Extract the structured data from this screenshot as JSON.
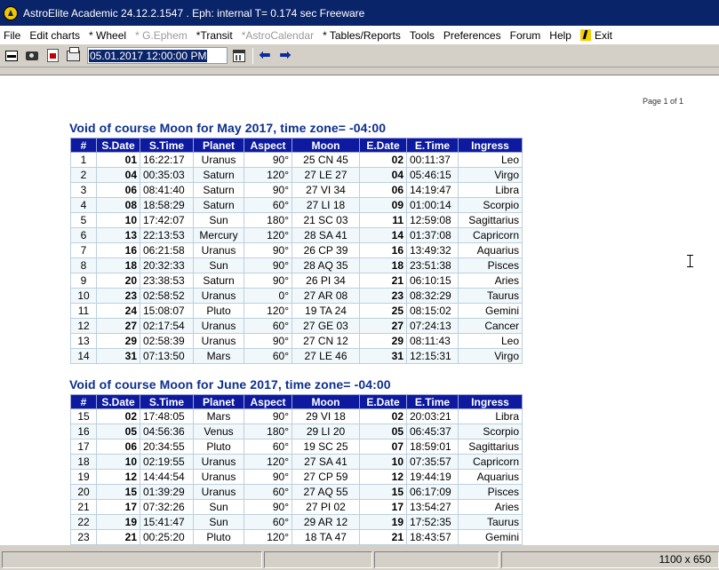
{
  "window": {
    "title": "AstroElite Academic 24.12.2.1547 . Eph: internal T= 0.174 sec Freeware"
  },
  "menu": {
    "items": [
      {
        "label": "File",
        "enabled": true
      },
      {
        "label": "Edit charts",
        "enabled": true
      },
      {
        "label": "* Wheel",
        "enabled": true
      },
      {
        "label": "* G.Ephem",
        "enabled": false
      },
      {
        "label": "*Transit",
        "enabled": true
      },
      {
        "label": "*AstroCalendar",
        "enabled": false
      },
      {
        "label": "* Tables/Reports",
        "enabled": true
      },
      {
        "label": "Tools",
        "enabled": true
      },
      {
        "label": "Preferences",
        "enabled": true
      },
      {
        "label": "Forum",
        "enabled": true
      },
      {
        "label": "Help",
        "enabled": true
      }
    ],
    "exit_label": "Exit"
  },
  "toolbar": {
    "datetime_value": "05.01.2017  12:00:00 PM",
    "icons": [
      "window-icon",
      "camera-icon",
      "pdf-icon",
      "printer-icon",
      "calendar-icon",
      "arrow-left-icon",
      "arrow-right-icon"
    ]
  },
  "report": {
    "page_label": "Page 1 of 1",
    "columns": [
      "#",
      "S.Date",
      "S.Time",
      "Planet",
      "Aspect",
      "Moon",
      "E.Date",
      "E.Time",
      "Ingress"
    ],
    "sections": [
      {
        "title": "Void of course Moon for  May 2017, time zone= -04:00",
        "rows": [
          [
            "1",
            "01",
            "16:22:17",
            "Uranus",
            "90°",
            "25 CN 45",
            "02",
            "00:11:37",
            "Leo"
          ],
          [
            "2",
            "04",
            "00:35:03",
            "Saturn",
            "120°",
            "27 LE 27",
            "04",
            "05:46:15",
            "Virgo"
          ],
          [
            "3",
            "06",
            "08:41:40",
            "Saturn",
            "90°",
            "27 VI 34",
            "06",
            "14:19:47",
            "Libra"
          ],
          [
            "4",
            "08",
            "18:58:29",
            "Saturn",
            "60°",
            "27 LI 18",
            "09",
            "01:00:14",
            "Scorpio"
          ],
          [
            "5",
            "10",
            "17:42:07",
            "Sun",
            "180°",
            "21 SC 03",
            "11",
            "12:59:08",
            "Sagittarius"
          ],
          [
            "6",
            "13",
            "22:13:53",
            "Mercury",
            "120°",
            "28 SA 41",
            "14",
            "01:37:08",
            "Capricorn"
          ],
          [
            "7",
            "16",
            "06:21:58",
            "Uranus",
            "90°",
            "26 CP 39",
            "16",
            "13:49:32",
            "Aquarius"
          ],
          [
            "8",
            "18",
            "20:32:33",
            "Sun",
            "90°",
            "28 AQ 35",
            "18",
            "23:51:38",
            "Pisces"
          ],
          [
            "9",
            "20",
            "23:38:53",
            "Saturn",
            "90°",
            "26 PI 34",
            "21",
            "06:10:15",
            "Aries"
          ],
          [
            "10",
            "23",
            "02:58:52",
            "Uranus",
            "0°",
            "27 AR 08",
            "23",
            "08:32:29",
            "Taurus"
          ],
          [
            "11",
            "24",
            "15:08:07",
            "Pluto",
            "120°",
            "19 TA 24",
            "25",
            "08:15:02",
            "Gemini"
          ],
          [
            "12",
            "27",
            "02:17:54",
            "Uranus",
            "60°",
            "27 GE 03",
            "27",
            "07:24:13",
            "Cancer"
          ],
          [
            "13",
            "29",
            "02:58:39",
            "Uranus",
            "90°",
            "27 CN 12",
            "29",
            "08:11:43",
            "Leo"
          ],
          [
            "14",
            "31",
            "07:13:50",
            "Mars",
            "60°",
            "27 LE 46",
            "31",
            "12:15:31",
            "Virgo"
          ]
        ]
      },
      {
        "title": "Void of course Moon for  June 2017, time zone= -04:00",
        "rows": [
          [
            "15",
            "02",
            "17:48:05",
            "Mars",
            "90°",
            "29 VI 18",
            "02",
            "20:03:21",
            "Libra"
          ],
          [
            "16",
            "05",
            "04:56:36",
            "Venus",
            "180°",
            "29 LI 20",
            "05",
            "06:45:37",
            "Scorpio"
          ],
          [
            "17",
            "06",
            "20:34:55",
            "Pluto",
            "60°",
            "19 SC 25",
            "07",
            "18:59:01",
            "Sagittarius"
          ],
          [
            "18",
            "10",
            "02:19:55",
            "Uranus",
            "120°",
            "27 SA 41",
            "10",
            "07:35:57",
            "Capricorn"
          ],
          [
            "19",
            "12",
            "14:44:54",
            "Uranus",
            "90°",
            "27 CP 59",
            "12",
            "19:44:19",
            "Aquarius"
          ],
          [
            "20",
            "15",
            "01:39:29",
            "Uranus",
            "60°",
            "27 AQ 55",
            "15",
            "06:17:09",
            "Pisces"
          ],
          [
            "21",
            "17",
            "07:32:26",
            "Sun",
            "90°",
            "27 PI 02",
            "17",
            "13:54:27",
            "Aries"
          ],
          [
            "22",
            "19",
            "15:41:47",
            "Sun",
            "60°",
            "29 AR 12",
            "19",
            "17:52:35",
            "Taurus"
          ],
          [
            "23",
            "21",
            "00:25:20",
            "Pluto",
            "120°",
            "18 TA 47",
            "21",
            "18:43:57",
            "Gemini"
          ]
        ]
      }
    ]
  },
  "status": {
    "size": "1100 x 650"
  }
}
